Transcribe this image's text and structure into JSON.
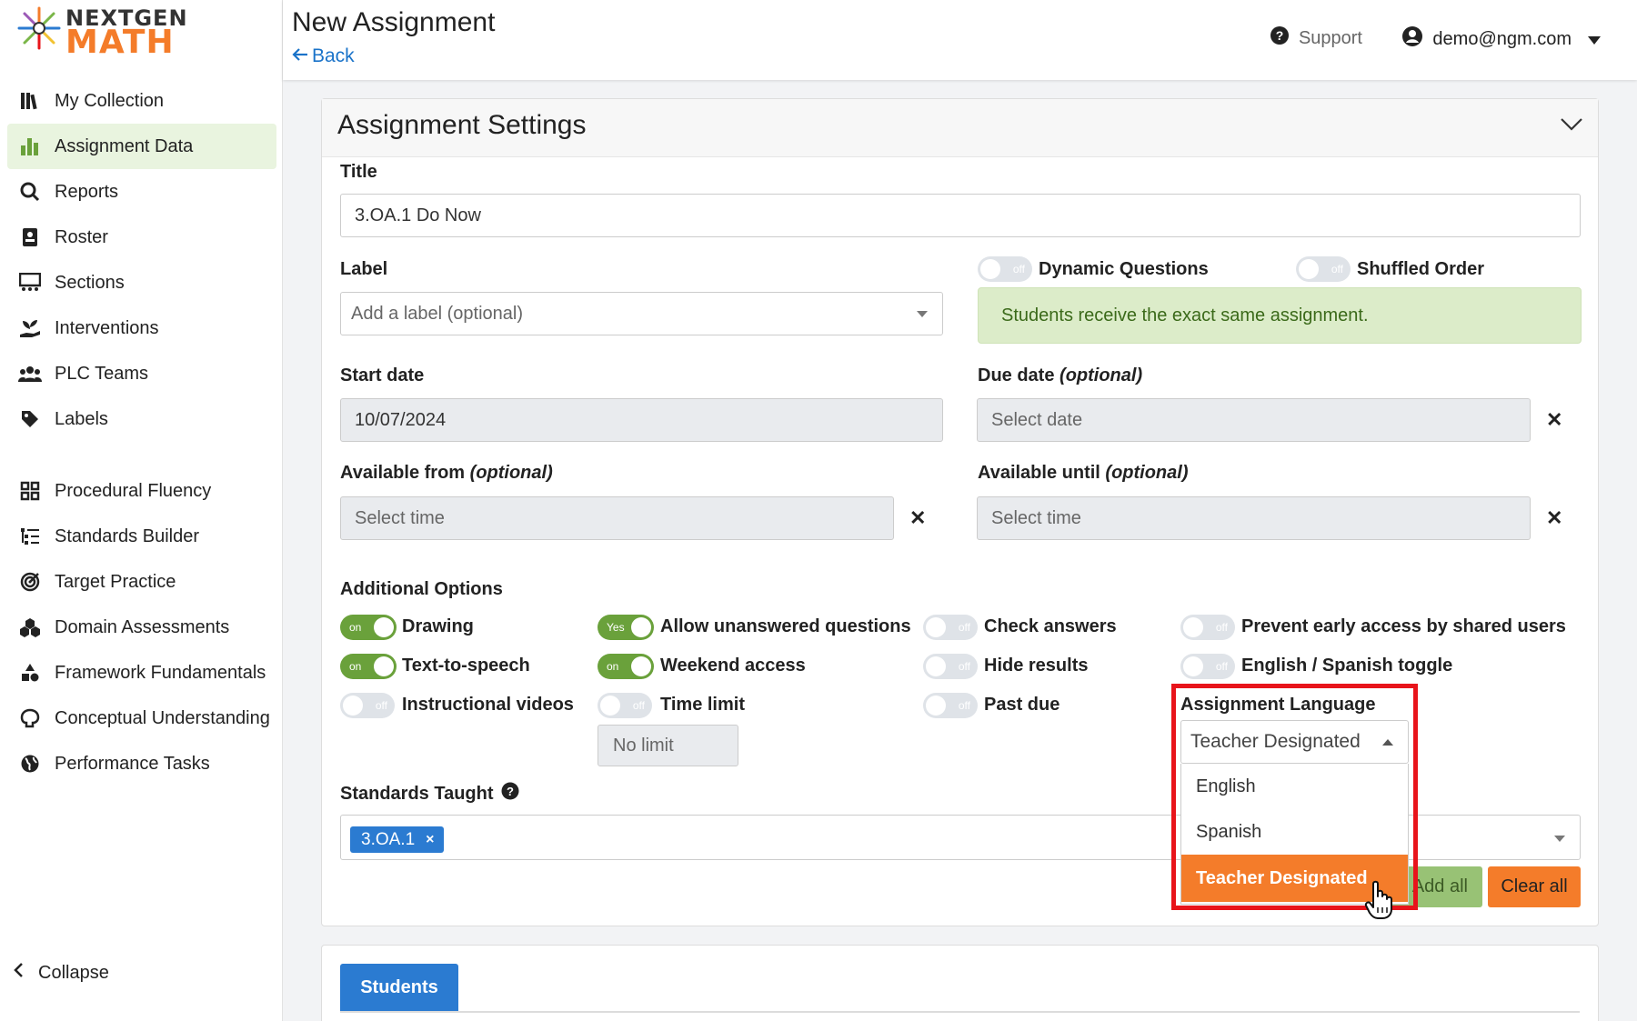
{
  "sidebar": {
    "logo_top": "NEXTGEN",
    "logo_bottom": "MATH",
    "group1": [
      {
        "label": "My Collection",
        "icon": "books-icon"
      },
      {
        "label": "Assignment Data",
        "icon": "bar-chart-icon",
        "active": true
      },
      {
        "label": "Reports",
        "icon": "search-chart-icon"
      },
      {
        "label": "Roster",
        "icon": "id-card-icon"
      },
      {
        "label": "Sections",
        "icon": "presentation-icon"
      },
      {
        "label": "Interventions",
        "icon": "hand-plant-icon"
      },
      {
        "label": "PLC Teams",
        "icon": "users-icon"
      },
      {
        "label": "Labels",
        "icon": "tag-icon"
      }
    ],
    "group2": [
      {
        "label": "Procedural Fluency",
        "icon": "grid-icon"
      },
      {
        "label": "Standards Builder",
        "icon": "list-tree-icon"
      },
      {
        "label": "Target Practice",
        "icon": "target-icon"
      },
      {
        "label": "Domain Assessments",
        "icon": "cubes-icon"
      },
      {
        "label": "Framework Fundamentals",
        "icon": "shapes-icon"
      },
      {
        "label": "Conceptual Understanding",
        "icon": "brain-icon"
      },
      {
        "label": "Performance Tasks",
        "icon": "globe-icon"
      }
    ],
    "collapse_label": "Collapse"
  },
  "header": {
    "title": "New Assignment",
    "back_label": "Back",
    "support_label": "Support",
    "user_email": "demo@ngm.com"
  },
  "settings": {
    "card_title": "Assignment Settings",
    "title_label": "Title",
    "title_value": "3.OA.1 Do Now",
    "label_label": "Label",
    "label_placeholder": "Add a label (optional)",
    "dynamic_questions_label": "Dynamic Questions",
    "shuffled_order_label": "Shuffled Order",
    "toggle_off_text": "off",
    "toggle_on_text": "on",
    "toggle_yes_text": "Yes",
    "same_assignment_notice": "Students receive the exact same assignment.",
    "start_date_label": "Start date",
    "start_date_value": "10/07/2024",
    "due_date_label": "Due date",
    "due_date_optional": "(optional)",
    "due_date_placeholder": "Select date",
    "available_from_label": "Available from",
    "available_from_optional": "(optional)",
    "available_from_placeholder": "Select time",
    "available_until_label": "Available until",
    "available_until_optional": "(optional)",
    "available_until_placeholder": "Select time",
    "clear_symbol": "✕",
    "additional_options_label": "Additional Options",
    "options": {
      "drawing": "Drawing",
      "allow_unanswered": "Allow unanswered questions",
      "check_answers": "Check answers",
      "prevent_early_access": "Prevent early access by shared users",
      "text_to_speech": "Text-to-speech",
      "weekend_access": "Weekend access",
      "hide_results": "Hide results",
      "english_spanish_toggle": "English / Spanish toggle",
      "instructional_videos": "Instructional videos",
      "time_limit": "Time limit",
      "past_due": "Past due"
    },
    "time_limit_value": "No limit",
    "assignment_language_label": "Assignment Language",
    "assignment_language_value": "Teacher Designated",
    "language_options": [
      "English",
      "Spanish",
      "Teacher Designated"
    ],
    "standards_taught_label": "Standards Taught",
    "standard_chip": "3.OA.1",
    "chip_remove": "×",
    "add_all_label": "Add all",
    "clear_all_label": "Clear all"
  },
  "students": {
    "tab_label": "Students"
  },
  "colors": {
    "accent_blue": "#2b7bd1",
    "accent_orange": "#f47c2a",
    "accent_green": "#6aa13b",
    "highlight_red": "#e8141b"
  }
}
